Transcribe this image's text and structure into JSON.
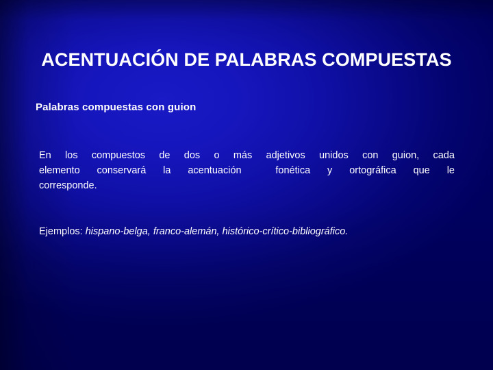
{
  "slide": {
    "background": {
      "base_color": "#00006e",
      "highlight_color": "#1a1ac6",
      "edge_color": "#000046"
    },
    "title": "ACENTUACIÓN DE PALABRAS COMPUESTAS",
    "subheading": "Palabras compuestas con guion",
    "body": {
      "line_1": "En los compuestos de dos o más adjetivos unidos con guion, cada",
      "line_2": "elemento conservará la acentuación  fonética y ortográfica que le",
      "line_3": "corresponde.",
      "full_text": "En los compuestos de dos o más adjetivos unidos con guion, cada elemento conservará la acentuación  fonética y ortográfica que le corresponde."
    },
    "examples": {
      "label": "Ejemplos: ",
      "items_text": "hispano-belga, franco-alemán, histórico-crítico-bibliográfico.",
      "items": [
        "hispano-belga",
        "franco-alemán",
        "histórico-crítico-bibliográfico"
      ]
    }
  }
}
